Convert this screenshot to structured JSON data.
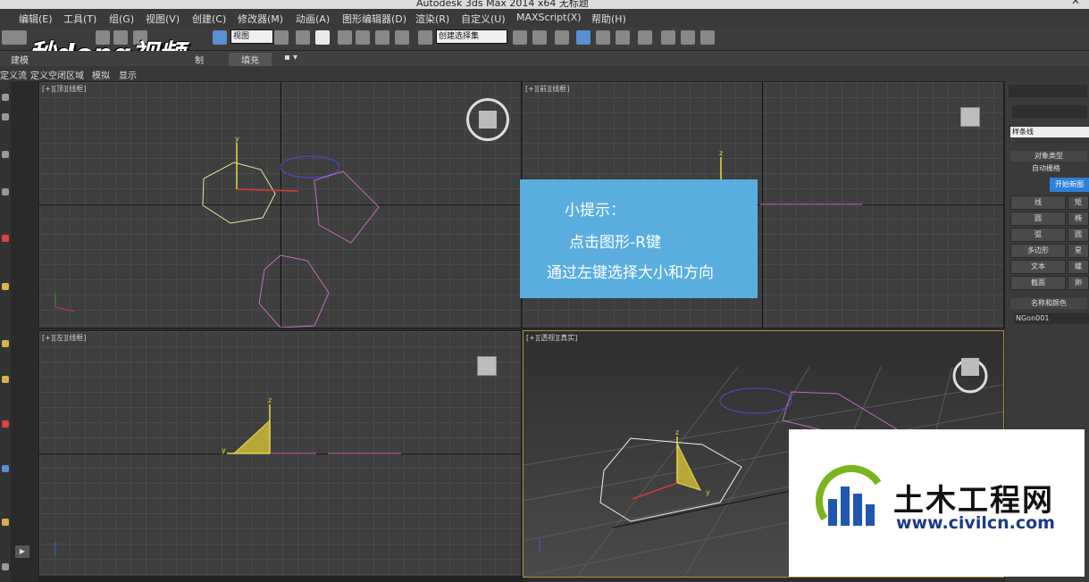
{
  "window": {
    "title": "Autodesk 3ds Max  2014 x64     无标题",
    "close_glyph": "✕"
  },
  "menu": [
    "编辑(E)",
    "工具(T)",
    "组(G)",
    "视图(V)",
    "创建(C)",
    "修改器(M)",
    "动画(A)",
    "图形编辑器(D)",
    "渲染(R)",
    "自定义(U)",
    "MAXScript(X)",
    "帮助(H)"
  ],
  "toolbar": {
    "view_select": "视图",
    "selection_set": "创建选择集"
  },
  "ribbon": {
    "items": [
      "建模",
      "制",
      "填充"
    ]
  },
  "subbar": {
    "items": [
      "定义流",
      "定义空闭区域",
      "模拟",
      "显示"
    ]
  },
  "watermark_top": "秒dong视频",
  "viewports": [
    {
      "label": "[+][顶][线框]"
    },
    {
      "label": "[+][前][线框]"
    },
    {
      "label": "[+][左][线框]"
    },
    {
      "label": "[+][透视][真实]"
    }
  ],
  "axis_letters": {
    "x": "x",
    "y": "y",
    "z": "z"
  },
  "right_panel": {
    "dropdown": "样条线",
    "rollout_object_type": "对象类型",
    "auto_grid": "自动栅格",
    "start_new_shape": "开始新图",
    "buttons": [
      "线",
      "圆",
      "弧",
      "多边形",
      "文本",
      "截面"
    ],
    "buttons_right": [
      "矩",
      "椭",
      "圆",
      "星",
      "螺",
      "卵"
    ],
    "rollout_name_color": "名称和颜色",
    "object_name": "NGon001"
  },
  "tip": {
    "title": "小提示：",
    "line1": "点击图形-R键",
    "line2": "通过左键选择大小和方向"
  },
  "watermark_bottom": {
    "name": "土木工程网",
    "url": "www.civilcn.com"
  },
  "colors": {
    "tip_bg": "#5aaedf",
    "selected_shape": "#e9e3a0",
    "shape": "#c76cc0",
    "circle": "#4b4bd8",
    "active_button": "#2f7fd8"
  }
}
